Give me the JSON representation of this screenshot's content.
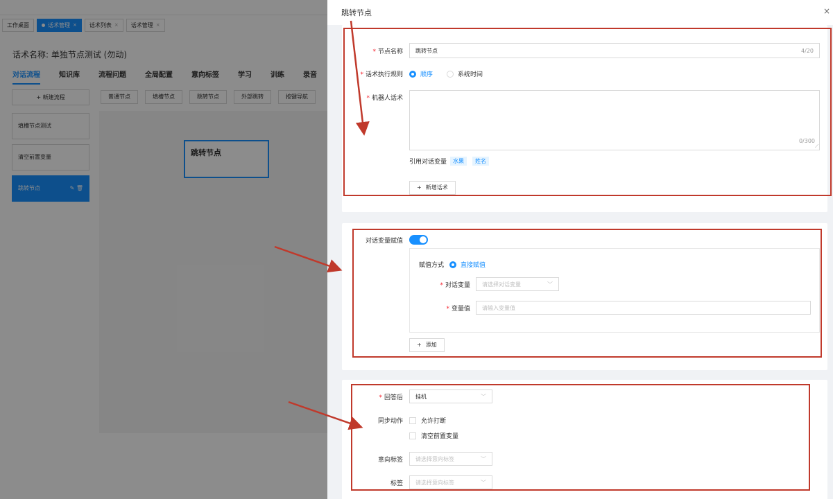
{
  "app": {
    "tabs": [
      {
        "label": "工作桌面",
        "active": false,
        "closable": false
      },
      {
        "label": "话术管理",
        "active": true,
        "closable": true
      },
      {
        "label": "话术列表",
        "active": false,
        "closable": true
      },
      {
        "label": "话术管理",
        "active": false,
        "closable": true
      }
    ],
    "script_title": "话术名称: 单独节点测试 (勿动)",
    "nav": [
      "对话流程",
      "知识库",
      "流程问题",
      "全局配置",
      "意向标签",
      "学习",
      "训练",
      "录音"
    ],
    "new_flow_label": "+ 新建流程",
    "flows": [
      "填槽节点测试",
      "清空前置变量",
      "跳转节点"
    ],
    "node_types": [
      "普通节点",
      "填槽节点",
      "跳转节点",
      "外部跳转",
      "按键导航"
    ],
    "canvas_node_label": "跳转节点"
  },
  "drawer": {
    "title": "跳转节点",
    "close_icon": "×",
    "section1": {
      "node_name_label": "节点名称",
      "node_name_value": "跳转节点",
      "node_name_counter": "4/20",
      "rule_label": "话术执行规则",
      "rule_options": [
        "顺序",
        "系统时间"
      ],
      "rule_selected": "顺序",
      "robot_label": "机器人话术",
      "robot_counter": "0/300",
      "ref_vars_label": "引用对话变量",
      "ref_vars": [
        "水果",
        "姓名"
      ],
      "add_script_label": "新增话术"
    },
    "section2": {
      "assign_label": "对话变量赋值",
      "assign_on": true,
      "method_label": "赋值方式",
      "method_option": "直接赋值",
      "var_label": "对话变量",
      "var_placeholder": "请选择对话变量",
      "value_label": "变量值",
      "value_placeholder": "请输入变量值",
      "add_label": "添加"
    },
    "section3": {
      "after_label": "回答后",
      "after_value": "挂机",
      "sync_label": "同步动作",
      "sync_options": [
        "允许打断",
        "清空前置变量"
      ],
      "intent_label": "意向标签",
      "intent_placeholder": "请选择意向标签",
      "tag_label": "标签",
      "tag_placeholder": "请选择意向标签"
    }
  },
  "colors": {
    "primary": "#1890ff",
    "required": "#f5222d",
    "annotation": "#c0392b"
  }
}
